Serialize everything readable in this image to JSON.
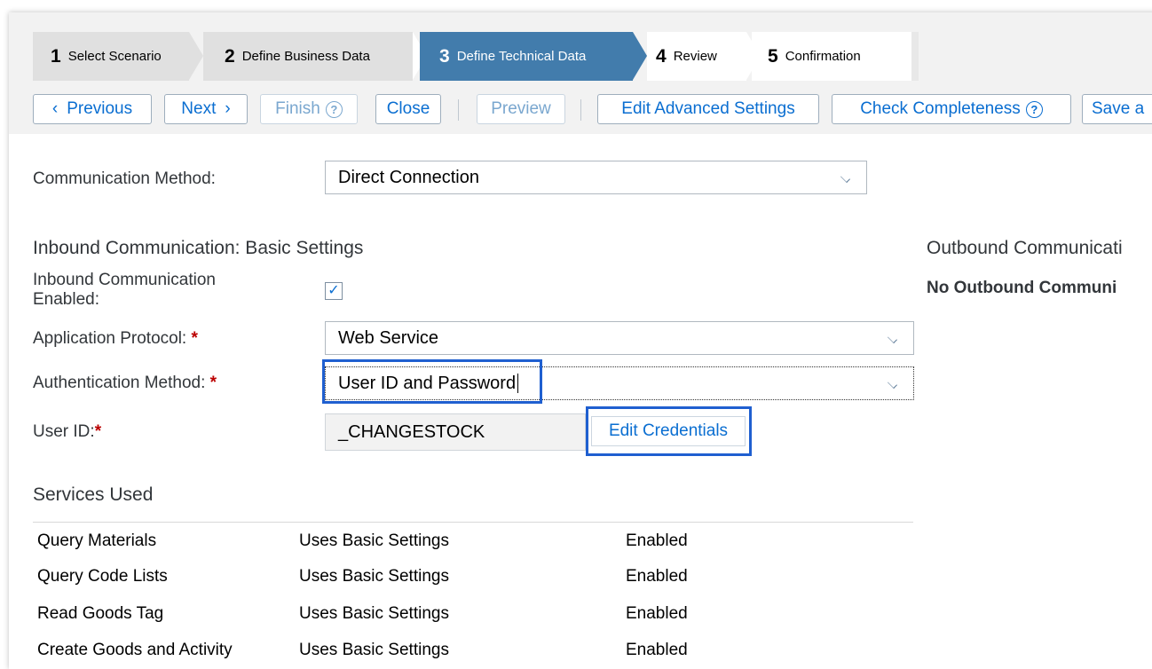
{
  "steps": [
    {
      "num": "1",
      "label": "Select Scenario",
      "state": "done"
    },
    {
      "num": "2",
      "label": "Define Business Data",
      "state": "done"
    },
    {
      "num": "3",
      "label": "Define Technical Data",
      "state": "active"
    },
    {
      "num": "4",
      "label": "Review",
      "state": "todo"
    },
    {
      "num": "5",
      "label": "Confirmation",
      "state": "todo"
    }
  ],
  "toolbar": {
    "previous_label": "Previous",
    "next_label": "Next",
    "finish_label": "Finish",
    "close_label": "Close",
    "preview_label": "Preview",
    "edit_advanced_label": "Edit Advanced Settings",
    "check_completeness_label": "Check Completeness",
    "save_label": "Save a"
  },
  "form": {
    "communication_method_label": "Communication Method:",
    "communication_method_value": "Direct Connection",
    "inbound_section_title": "Inbound Communication: Basic Settings",
    "inbound_enabled_label_line1": "Inbound Communication",
    "inbound_enabled_label_line2": "Enabled:",
    "inbound_enabled": true,
    "application_protocol_label": "Application Protocol:",
    "application_protocol_value": "Web Service",
    "authentication_method_label": "Authentication Method:",
    "authentication_method_value": "User ID and Password",
    "user_id_label": "User ID:",
    "user_id_value": "_CHANGESTOCK",
    "edit_credentials_label": "Edit Credentials",
    "required_mark": "*"
  },
  "outbound": {
    "title": "Outbound Communicati",
    "message": "No Outbound Communi"
  },
  "services": {
    "title": "Services Used",
    "rows": [
      {
        "name": "Query Materials",
        "settings": "Uses Basic Settings",
        "status": "Enabled"
      },
      {
        "name": "Query Code Lists",
        "settings": "Uses Basic Settings",
        "status": "Enabled"
      },
      {
        "name": "Read Goods Tag",
        "settings": "Uses Basic Settings",
        "status": "Enabled"
      },
      {
        "name": "Create Goods and Activity",
        "settings": "Uses Basic Settings",
        "status": "Enabled"
      }
    ]
  },
  "colors": {
    "active_step": "#427cac",
    "link_blue": "#0a6ed1",
    "highlight": "#1f5fd0",
    "required": "#bb0000"
  },
  "icons": {
    "previous": "chevron-left-icon",
    "next": "chevron-right-icon",
    "help": "question-circle-icon",
    "dropdown": "chevron-down-icon",
    "check": "checkmark-icon"
  }
}
